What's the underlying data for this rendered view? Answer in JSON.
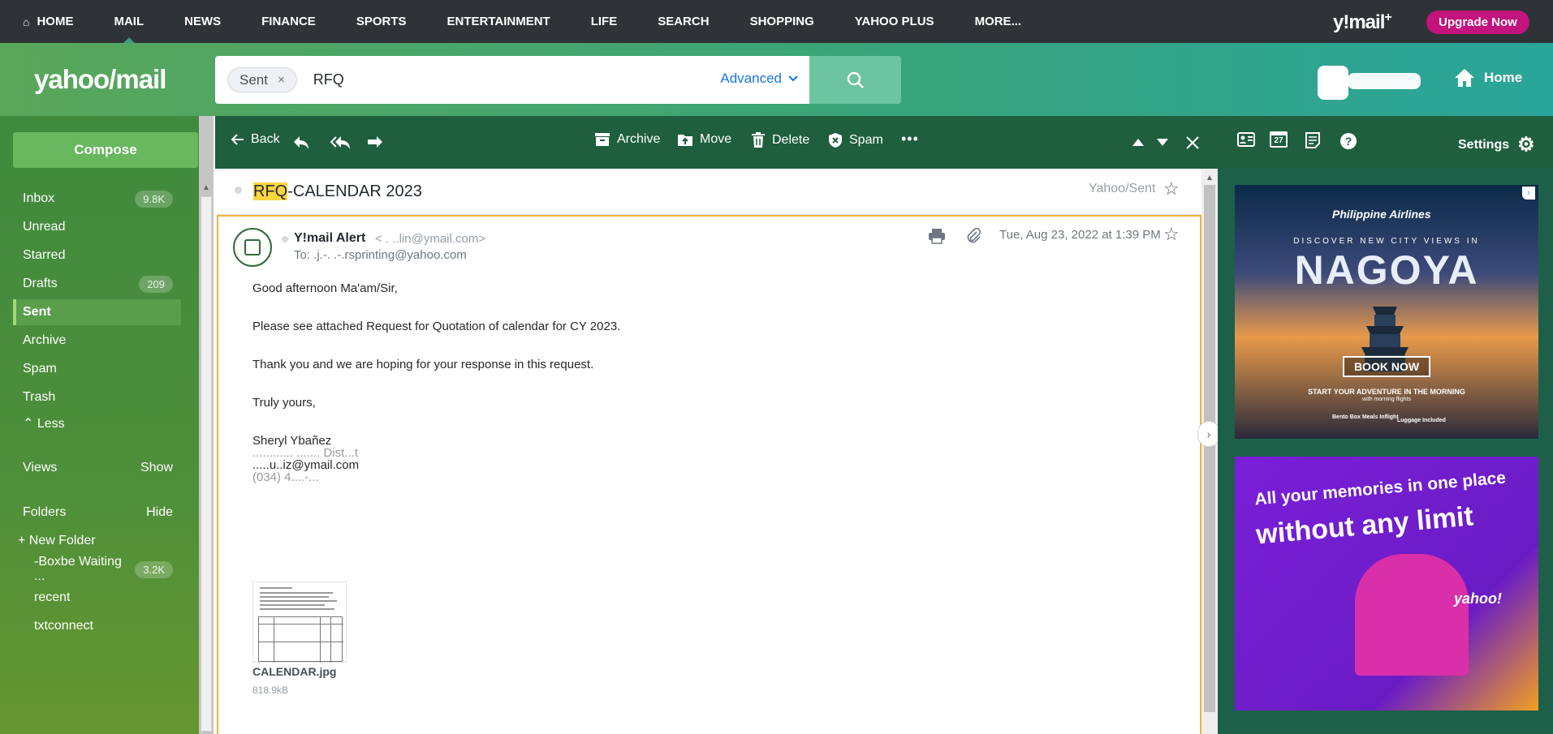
{
  "topnav": {
    "items": [
      "HOME",
      "MAIL",
      "NEWS",
      "FINANCE",
      "SPORTS",
      "ENTERTAINMENT",
      "LIFE",
      "SEARCH",
      "SHOPPING",
      "YAHOO PLUS",
      "MORE..."
    ],
    "active": "MAIL",
    "brand": "y!mail",
    "brand_plus": "+",
    "upgrade": "Upgrade Now"
  },
  "header": {
    "logo": "yahoo/mail",
    "search_chip": "Sent",
    "search_chip_close": "×",
    "search_query": "RFQ",
    "advanced": "Advanced",
    "home_link": "Home"
  },
  "sidebar": {
    "compose": "Compose",
    "folders": [
      {
        "label": "Inbox",
        "count": "9.8K"
      },
      {
        "label": "Unread",
        "count": ""
      },
      {
        "label": "Starred",
        "count": ""
      },
      {
        "label": "Drafts",
        "count": "209"
      },
      {
        "label": "Sent",
        "count": ""
      },
      {
        "label": "Archive",
        "count": ""
      },
      {
        "label": "Spam",
        "count": ""
      },
      {
        "label": "Trash",
        "count": ""
      }
    ],
    "active_folder": "Sent",
    "less": "Less",
    "views": "Views",
    "views_action": "Show",
    "folders_label": "Folders",
    "folders_action": "Hide",
    "new_folder": "New Folder",
    "custom_folders": [
      {
        "label": "-Boxbe Waiting ...",
        "count": "3.2K"
      },
      {
        "label": "recent",
        "count": ""
      },
      {
        "label": "txtconnect",
        "count": ""
      }
    ]
  },
  "toolbar": {
    "back": "Back",
    "archive": "Archive",
    "move": "Move",
    "delete": "Delete",
    "spam": "Spam",
    "more": "•••"
  },
  "message": {
    "subject_highlight": "RFQ",
    "subject_rest": "-CALENDAR 2023",
    "folder_path": "Yahoo/Sent",
    "sender_name": "Y!mail Alert",
    "sender_email": "<       .    ..lin@ymail.com>",
    "to": "To:  .j.-. .-.rsprinting@yahoo.com",
    "date": "Tue, Aug 23, 2022 at 1:39 PM",
    "body_lines": [
      "Good afternoon Ma'am/Sir,",
      "Please see attached Request for Quotation of calendar for CY 2023.",
      "Thank you and we are hoping for your response in this request.",
      "Truly yours,",
      "Sheryl Ybañez",
      "............ .......  Dist...t",
      ".....u..iz@ymail.com",
      "(034) 4....-..."
    ],
    "attachment_name": "CALENDAR.jpg",
    "attachment_size": "818.9kB"
  },
  "rail": {
    "calendar_day": "27",
    "settings": "Settings"
  },
  "ads": {
    "ad1": {
      "airline": "Philippine Airlines",
      "discover": "DISCOVER NEW CITY VIEWS IN",
      "city": "NAGOYA",
      "cta": "BOOK NOW",
      "tagline": "START YOUR ADVENTURE IN THE MORNING",
      "subtagline": "with morning flights",
      "feature1": "Bento Box Meals Inflight",
      "feature2": "Luggage Included"
    },
    "ad2": {
      "line1": "All your memories in one place",
      "line2": "without any limit",
      "brand": "yahoo!"
    }
  },
  "colors": {
    "topnav_bg": "#2e3338",
    "upgrade": "#c3137d",
    "toolbar_bg": "#1f5f3d",
    "highlight": "#fcd53f",
    "selected_border": "#f0b23c"
  }
}
